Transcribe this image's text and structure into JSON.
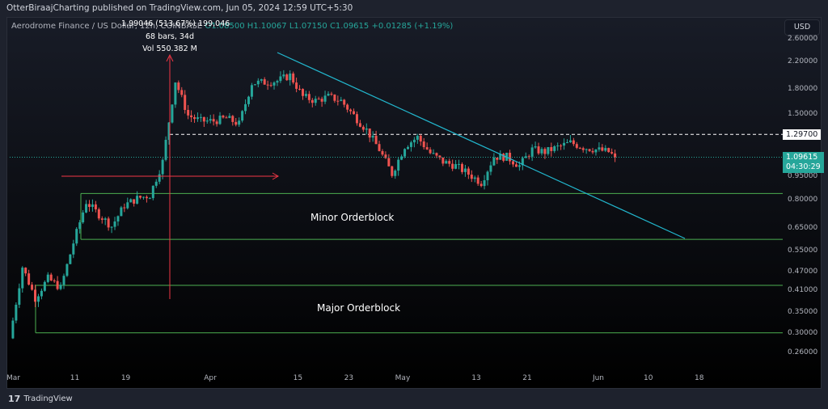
{
  "header": {
    "published": "OtterBiraajCharting published on TradingView.com, Jun 05, 2024 12:59 UTC+5:30"
  },
  "legend": {
    "symbol": "Aerodrome Finance / US Dollar, 12h, COINBASE",
    "open": "O1.08500",
    "high": "H1.10067",
    "low": "L1.07150",
    "close": "C1.09615",
    "change": "+0.01285 (+1.19%)"
  },
  "measure": {
    "line1": "1.99046 (513.67%) 199,046",
    "line2": "68 bars, 34d",
    "line3": "Vol 550.382 M"
  },
  "price_axis": {
    "currency": "USD",
    "current_price": "1.09615",
    "countdown": "04:30:29",
    "level_label": "1.29700"
  },
  "annotations": {
    "minor": "Minor Orderblock",
    "major": "Major Orderblock"
  },
  "footer": {
    "brand": "TradingView"
  },
  "colors": {
    "up": "#26a69a",
    "down": "#ef5350",
    "trendline": "#22b8cf",
    "orderblock": "#4caf50",
    "measure": "#f23645",
    "current": "#26a69a"
  },
  "chart_data": {
    "type": "candlestick",
    "interval": "12h",
    "yscale": "log",
    "ylim": [
      0.23,
      2.8
    ],
    "yticks": [
      "2.60000",
      "2.20000",
      "1.80000",
      "1.50000",
      "0.95000",
      "0.80000",
      "0.65000",
      "0.55000",
      "0.47000",
      "0.41000",
      "0.35000",
      "0.30000",
      "0.26000"
    ],
    "xticks": [
      "Mar",
      "11",
      "19",
      "Apr",
      "15",
      "23",
      "May",
      "13",
      "21",
      "Jun",
      "10",
      "18"
    ],
    "approx_close": [
      [
        "Mar 1",
        0.29
      ],
      [
        "Mar 3",
        0.49
      ],
      [
        "Mar 5",
        0.39
      ],
      [
        "Mar 7",
        0.45
      ],
      [
        "Mar 9",
        0.42
      ],
      [
        "Mar 11",
        0.585
      ],
      [
        "Mar 13",
        0.79
      ],
      [
        "Mar 15",
        0.72
      ],
      [
        "Mar 17",
        0.66
      ],
      [
        "Mar 19",
        0.77
      ],
      [
        "Mar 21",
        0.81
      ],
      [
        "Mar 23",
        0.83
      ],
      [
        "Mar 25",
        1.06
      ],
      [
        "Mar 27",
        1.92
      ],
      [
        "Mar 29",
        1.49
      ],
      [
        "Mar 31",
        1.43
      ],
      [
        "Apr 2",
        1.43
      ],
      [
        "Apr 4",
        1.46
      ],
      [
        "Apr 6",
        1.4
      ],
      [
        "Apr 8",
        1.89
      ],
      [
        "Apr 10",
        1.9
      ],
      [
        "Apr 12",
        1.92
      ],
      [
        "Apr 14",
        2.0
      ],
      [
        "Apr 16",
        1.71
      ],
      [
        "Apr 18",
        1.66
      ],
      [
        "Apr 20",
        1.71
      ],
      [
        "Apr 22",
        1.66
      ],
      [
        "Apr 24",
        1.49
      ],
      [
        "Apr 26",
        1.34
      ],
      [
        "Apr 28",
        1.16
      ],
      [
        "Apr 30",
        0.97
      ],
      [
        "May 2",
        1.19
      ],
      [
        "May 4",
        1.27
      ],
      [
        "May 6",
        1.13
      ],
      [
        "May 8",
        1.06
      ],
      [
        "May 10",
        1.03
      ],
      [
        "May 12",
        0.97
      ],
      [
        "May 14",
        0.91
      ],
      [
        "May 16",
        1.1
      ],
      [
        "May 18",
        1.1
      ],
      [
        "May 20",
        1.03
      ],
      [
        "May 22",
        1.16
      ],
      [
        "May 24",
        1.14
      ],
      [
        "May 26",
        1.18
      ],
      [
        "May 28",
        1.22
      ],
      [
        "May 30",
        1.18
      ],
      [
        "Jun 1",
        1.16
      ],
      [
        "Jun 3",
        1.14
      ],
      [
        "Jun 4",
        1.09615
      ]
    ],
    "levels": {
      "resistance": 1.297,
      "minor_orderblock": [
        0.6,
        0.84
      ],
      "major_orderblock": [
        0.302,
        0.428
      ]
    }
  }
}
